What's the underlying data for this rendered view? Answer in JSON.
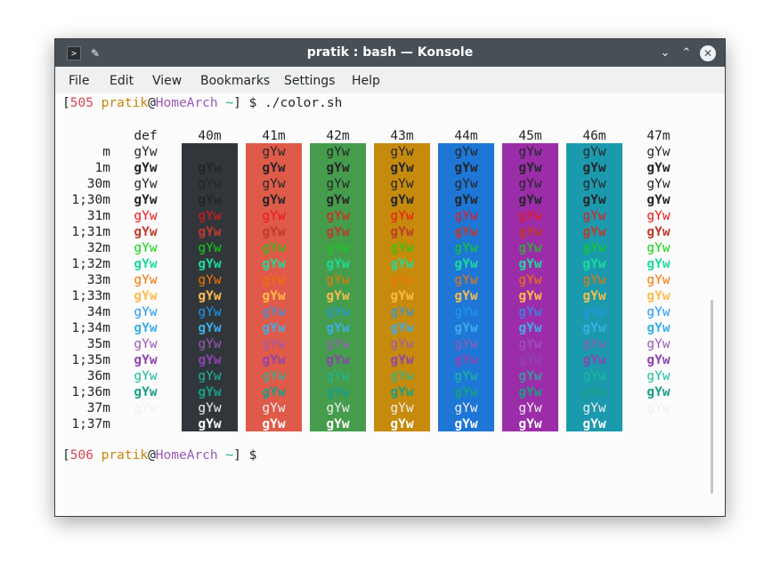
{
  "window": {
    "title": "pratik : bash — Konsole"
  },
  "icons": {
    "app": "terminal-icon",
    "pin": "pin-icon",
    "minimize": "chevron-down-icon",
    "maximize": "chevron-up-icon",
    "close": "close-icon"
  },
  "menu": [
    "File",
    "Edit",
    "View",
    "Bookmarks",
    "Settings",
    "Help"
  ],
  "prompt1": {
    "open": "[",
    "num": "505",
    "user": "pratik",
    "at": "@",
    "host": "HomeArch",
    "tilde": "~",
    "close": "] $ ",
    "cmd": "./color.sh"
  },
  "prompt2": {
    "open": "[",
    "num": "506",
    "user": "pratik",
    "at": "@",
    "host": "HomeArch",
    "tilde": "~",
    "close": "] $"
  },
  "sample_text": "gYw",
  "columns": [
    "def",
    "40m",
    "41m",
    "42m",
    "43m",
    "44m",
    "45m",
    "46m",
    "47m"
  ],
  "rows": [
    "m",
    "1m",
    "30m",
    "1;30m",
    "31m",
    "1;31m",
    "32m",
    "1;32m",
    "33m",
    "1;33m",
    "34m",
    "1;34m",
    "35m",
    "1;35m",
    "36m",
    "1;36m",
    "37m",
    "1;37m"
  ],
  "colors": {
    "background": [
      "transparent",
      "#31363b",
      "#e05a4a",
      "#459c4d",
      "#c68a0d",
      "#1e76d6",
      "#9c2da8",
      "#1a9aac",
      "transparent"
    ],
    "foreground": [
      "#232627",
      "#232627",
      "#232627",
      "#232627",
      "#ed1515",
      "#c0392b",
      "#11d116",
      "#1cdc9a",
      "#f67400",
      "#fdbc4b",
      "#1d99f3",
      "#3daee9",
      "#9b59b6",
      "#8e44ad",
      "#1abc9c",
      "#16a085",
      "#eff0f1",
      "#fcfcfc"
    ]
  }
}
